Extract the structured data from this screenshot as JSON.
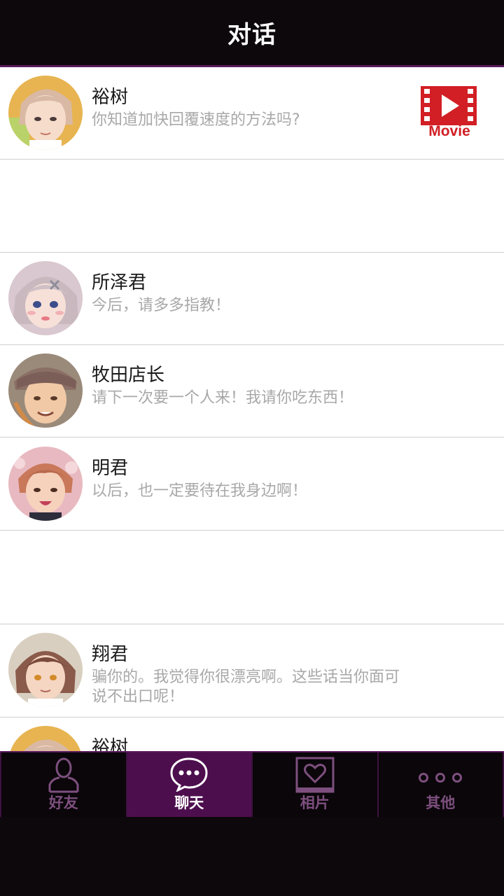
{
  "header": {
    "title": "对话"
  },
  "movie_badge": {
    "label": "Movie"
  },
  "conversations": [
    {
      "name": "裕树",
      "message": "你知道加快回覆速度的方法吗?"
    },
    {
      "name": "所泽君",
      "message": "今后，请多多指教！"
    },
    {
      "name": "牧田店长",
      "message": "请下一次要一个人来！我请你吃东西！"
    },
    {
      "name": "明君",
      "message": "以后，也一定要待在我身边啊！"
    },
    {
      "name": "翔君",
      "message": "骗你的。我觉得你很漂亮啊。这些话当你面可说不出口呢！"
    },
    {
      "name": "裕树",
      "message": ""
    }
  ],
  "tabs": [
    {
      "label": "好友",
      "icon": "person-icon"
    },
    {
      "label": "聊天",
      "icon": "chat-bubble-icon"
    },
    {
      "label": "相片",
      "icon": "heart-photo-icon"
    },
    {
      "label": "其他",
      "icon": "more-dots-icon"
    }
  ],
  "colors": {
    "accent": "#5a1a5c",
    "active_tab": "#4d0e4e",
    "movie_red": "#d11f25",
    "message_gray": "#a8a8a8"
  }
}
